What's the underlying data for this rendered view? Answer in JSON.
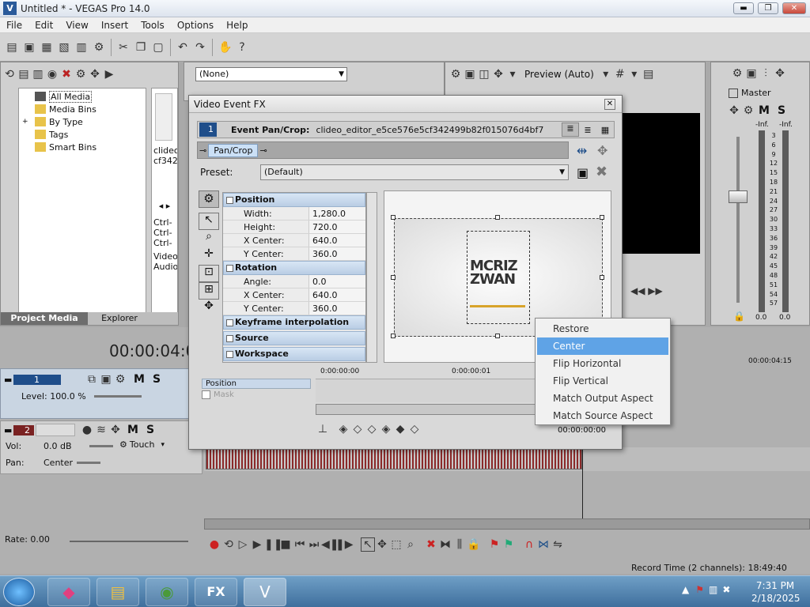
{
  "window": {
    "title": "Untitled * - VEGAS Pro 14.0"
  },
  "menu": [
    "File",
    "Edit",
    "View",
    "Insert",
    "Tools",
    "Options",
    "Help"
  ],
  "media_tree": {
    "items": [
      "All Media",
      "Media Bins",
      "By Type",
      "Tags",
      "Smart Bins"
    ],
    "media_text": [
      "clideo",
      "cf342"
    ],
    "ctrl_labels": [
      "Ctrl-",
      "Ctrl-",
      "Ctrl-"
    ],
    "video_label": "Video:",
    "audio_label": "Audio:"
  },
  "bottom_tabs": {
    "project_media": "Project Media",
    "explorer": "Explorer"
  },
  "preview": {
    "dropdown_value": "(None)",
    "preview_quality": "Preview (Auto)"
  },
  "master": {
    "label": "Master",
    "m": "M",
    "s": "S",
    "inf_left": "-Inf.",
    "inf_right": "-Inf.",
    "scale": [
      "3",
      "6",
      "9",
      "12",
      "15",
      "18",
      "21",
      "24",
      "27",
      "30",
      "33",
      "36",
      "39",
      "42",
      "45",
      "48",
      "51",
      "54",
      "57"
    ],
    "bottom_left": "0.0",
    "bottom_right": "0.0"
  },
  "fx_dialog": {
    "title": "Video Event FX",
    "event_num": "1",
    "event_label": "Event Pan/Crop:",
    "event_name": "clideo_editor_e5ce576e5cf342499b82f015076d4bf7",
    "chain_button": "Pan/Crop",
    "preset_label": "Preset:",
    "preset_value": "(Default)",
    "sections": {
      "position": {
        "title": "Position",
        "rows": [
          {
            "k": "Width:",
            "v": "1,280.0"
          },
          {
            "k": "Height:",
            "v": "720.0"
          },
          {
            "k": "X Center:",
            "v": "640.0"
          },
          {
            "k": "Y Center:",
            "v": "360.0"
          }
        ]
      },
      "rotation": {
        "title": "Rotation",
        "rows": [
          {
            "k": "Angle:",
            "v": "0.0"
          },
          {
            "k": "X Center:",
            "v": "640.0"
          },
          {
            "k": "Y Center:",
            "v": "360.0"
          }
        ]
      },
      "keyframe": "Keyframe interpolation",
      "source": "Source",
      "workspace": "Workspace"
    },
    "logo_text": [
      "MCRIZ",
      "ZWAN"
    ],
    "timeline": {
      "position_track": "Position",
      "mask_track": "Mask",
      "t0": "0:00:00:00",
      "t1": "0:00:00:01",
      "t_end": "00:00:00:00"
    }
  },
  "context_menu": {
    "items": [
      "Restore",
      "Center",
      "Flip Horizontal",
      "Flip Vertical",
      "Match Output Aspect",
      "Match Source Aspect"
    ],
    "selected": "Center"
  },
  "timeline": {
    "timecode": "00:00:04:0",
    "ruler_right": "00:00:04:15",
    "track1": {
      "num": "1",
      "level": "Level: 100.0 %",
      "m": "M",
      "s": "S"
    },
    "track2": {
      "num": "2",
      "vol_label": "Vol:",
      "vol_value": "0.0 dB",
      "pan_label": "Pan:",
      "pan_value": "Center",
      "touch": "Touch",
      "m": "M",
      "s": "S"
    },
    "rate": "Rate: 0.00",
    "record_time": "Record Time (2 channels): 18:49:40"
  },
  "taskbar": {
    "time": "7:31 PM",
    "date": "2/18/2025"
  }
}
